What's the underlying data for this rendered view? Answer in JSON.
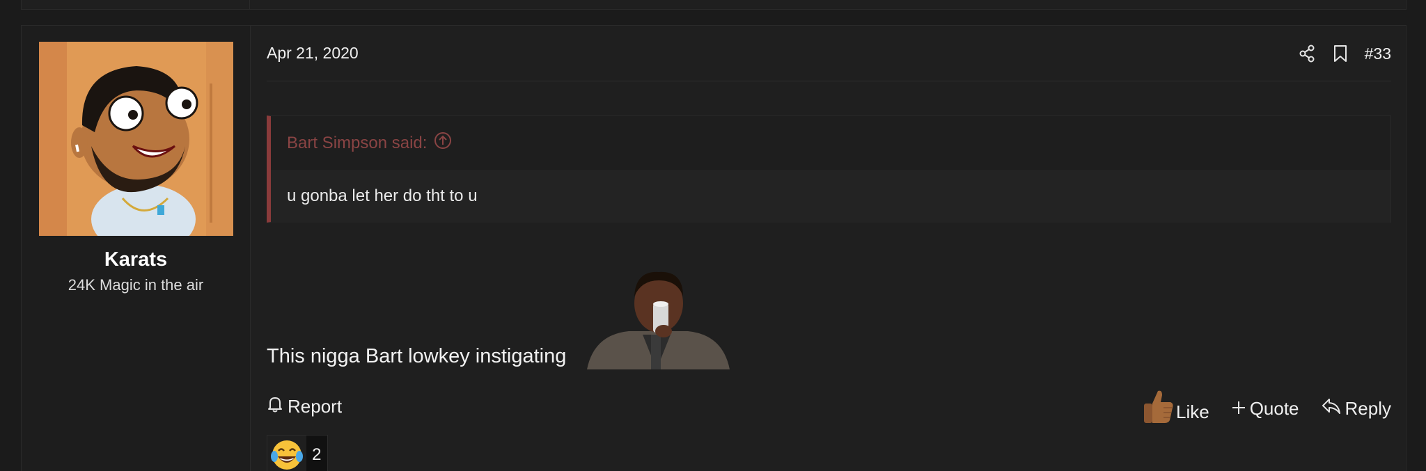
{
  "post": {
    "author": {
      "name": "Karats",
      "title": "24K Magic in the air"
    },
    "date": "Apr 21, 2020",
    "number": "#33",
    "quote": {
      "attribution": "Bart Simpson said:",
      "text": "u gonba let her do tht to u"
    },
    "body_text": "This nigga Bart lowkey instigating",
    "actions": {
      "report": "Report",
      "like": "Like",
      "quote": "Quote",
      "reply": "Reply"
    },
    "reactions": {
      "emoji_icon": "laughing-tears-emoji",
      "count": "2"
    },
    "icons": [
      "share-icon",
      "bookmark-icon",
      "bell-icon",
      "thumbs-up-icon",
      "plus-icon",
      "reply-arrow-icon",
      "arrow-up-circle-icon"
    ],
    "colors": {
      "quote_accent": "#8a3b3b",
      "background": "#1b1b1b"
    }
  }
}
